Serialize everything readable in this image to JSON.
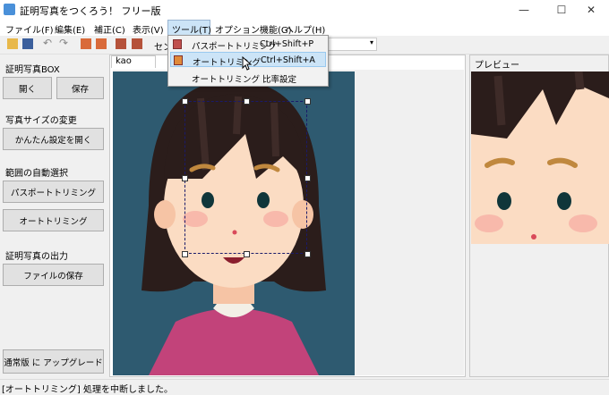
{
  "window": {
    "title": "証明写真をつくろう！ フリー版",
    "minimize": "—",
    "maximize": "☐",
    "close": "✕"
  },
  "menubar": {
    "items": [
      {
        "label": "ファイル(F)"
      },
      {
        "label": "編集(E)"
      },
      {
        "label": "補正(C)"
      },
      {
        "label": "表示(V)"
      },
      {
        "label": "ツール(T)"
      },
      {
        "label": "オプション機能(G)"
      },
      {
        "label": "ヘルプ(H)"
      }
    ]
  },
  "toolbar": {
    "center_label": "セン",
    "combo_value": "調整"
  },
  "sidebar": {
    "box_title": "証明写真BOX",
    "open": "開く",
    "save": "保存",
    "size_title": "写真サイズの変更",
    "easy_settings": "かんたん設定を開く",
    "auto_select_title": "範囲の自動選択",
    "passport_trimming": "パスポートトリミング",
    "auto_trimming": "オートトリミング",
    "output_title": "証明写真の出力",
    "save_file": "ファイルの保存",
    "upgrade": "通常版 に アップグレード"
  },
  "canvas": {
    "tab_label": "kao"
  },
  "preview": {
    "label": "プレビュー"
  },
  "dropdown": {
    "items": [
      {
        "label": "パスポートトリミング",
        "shortcut": "Ctrl+Shift+P"
      },
      {
        "label": "オートトリミング",
        "shortcut": "Ctrl+Shift+A"
      },
      {
        "label": "オートトリミング 比率設定",
        "shortcut": ""
      }
    ]
  },
  "status": {
    "text": "[オートトリミング] 処理を中断しました。"
  },
  "colors": {
    "menu_highlight": "#cce4f7",
    "photo_bg": "#2e5a70",
    "skin": "#fbdcc3",
    "hair": "#2b1d1b"
  }
}
